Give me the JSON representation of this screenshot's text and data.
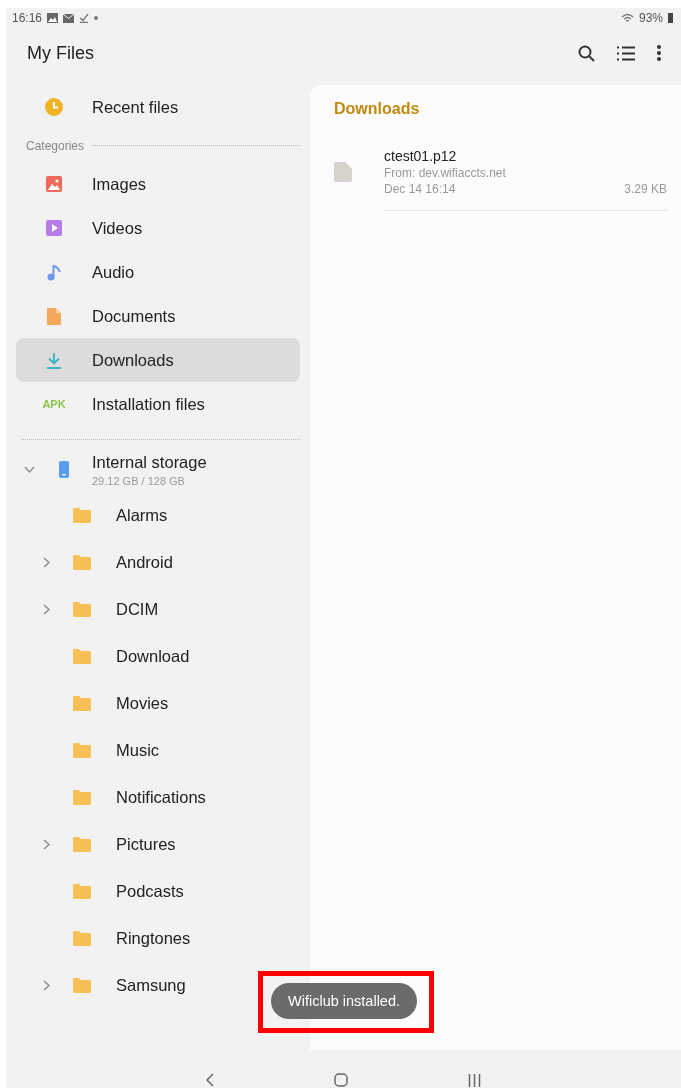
{
  "status_bar": {
    "time": "16:16",
    "battery": "93%"
  },
  "app_bar": {
    "title": "My Files"
  },
  "sidebar": {
    "recent": {
      "label": "Recent files",
      "selected": false
    },
    "categories_label": "Categories",
    "categories": [
      {
        "kind": "images",
        "label": "Images",
        "selected": false
      },
      {
        "kind": "videos",
        "label": "Videos",
        "selected": false
      },
      {
        "kind": "audio",
        "label": "Audio",
        "selected": false
      },
      {
        "kind": "documents",
        "label": "Documents",
        "selected": false
      },
      {
        "kind": "downloads",
        "label": "Downloads",
        "selected": true
      },
      {
        "kind": "apk",
        "label": "Installation files",
        "icon_text": "APK",
        "selected": false
      }
    ],
    "storage": {
      "label": "Internal storage",
      "detail": "29.12 GB / 128 GB",
      "expanded": true
    },
    "folders": [
      {
        "name": "Alarms",
        "expandable": false
      },
      {
        "name": "Android",
        "expandable": true
      },
      {
        "name": "DCIM",
        "expandable": true
      },
      {
        "name": "Download",
        "expandable": false
      },
      {
        "name": "Movies",
        "expandable": false
      },
      {
        "name": "Music",
        "expandable": false
      },
      {
        "name": "Notifications",
        "expandable": false
      },
      {
        "name": "Pictures",
        "expandable": true
      },
      {
        "name": "Podcasts",
        "expandable": false
      },
      {
        "name": "Ringtones",
        "expandable": false
      },
      {
        "name": "Samsung",
        "expandable": true
      }
    ]
  },
  "content": {
    "title": "Downloads",
    "files": [
      {
        "name": "ctest01.p12",
        "source": "From: dev.wifiaccts.net",
        "date": "Dec 14 16:14",
        "size": "3.29 KB"
      }
    ]
  },
  "toast": {
    "text": "Wificlub installed."
  }
}
